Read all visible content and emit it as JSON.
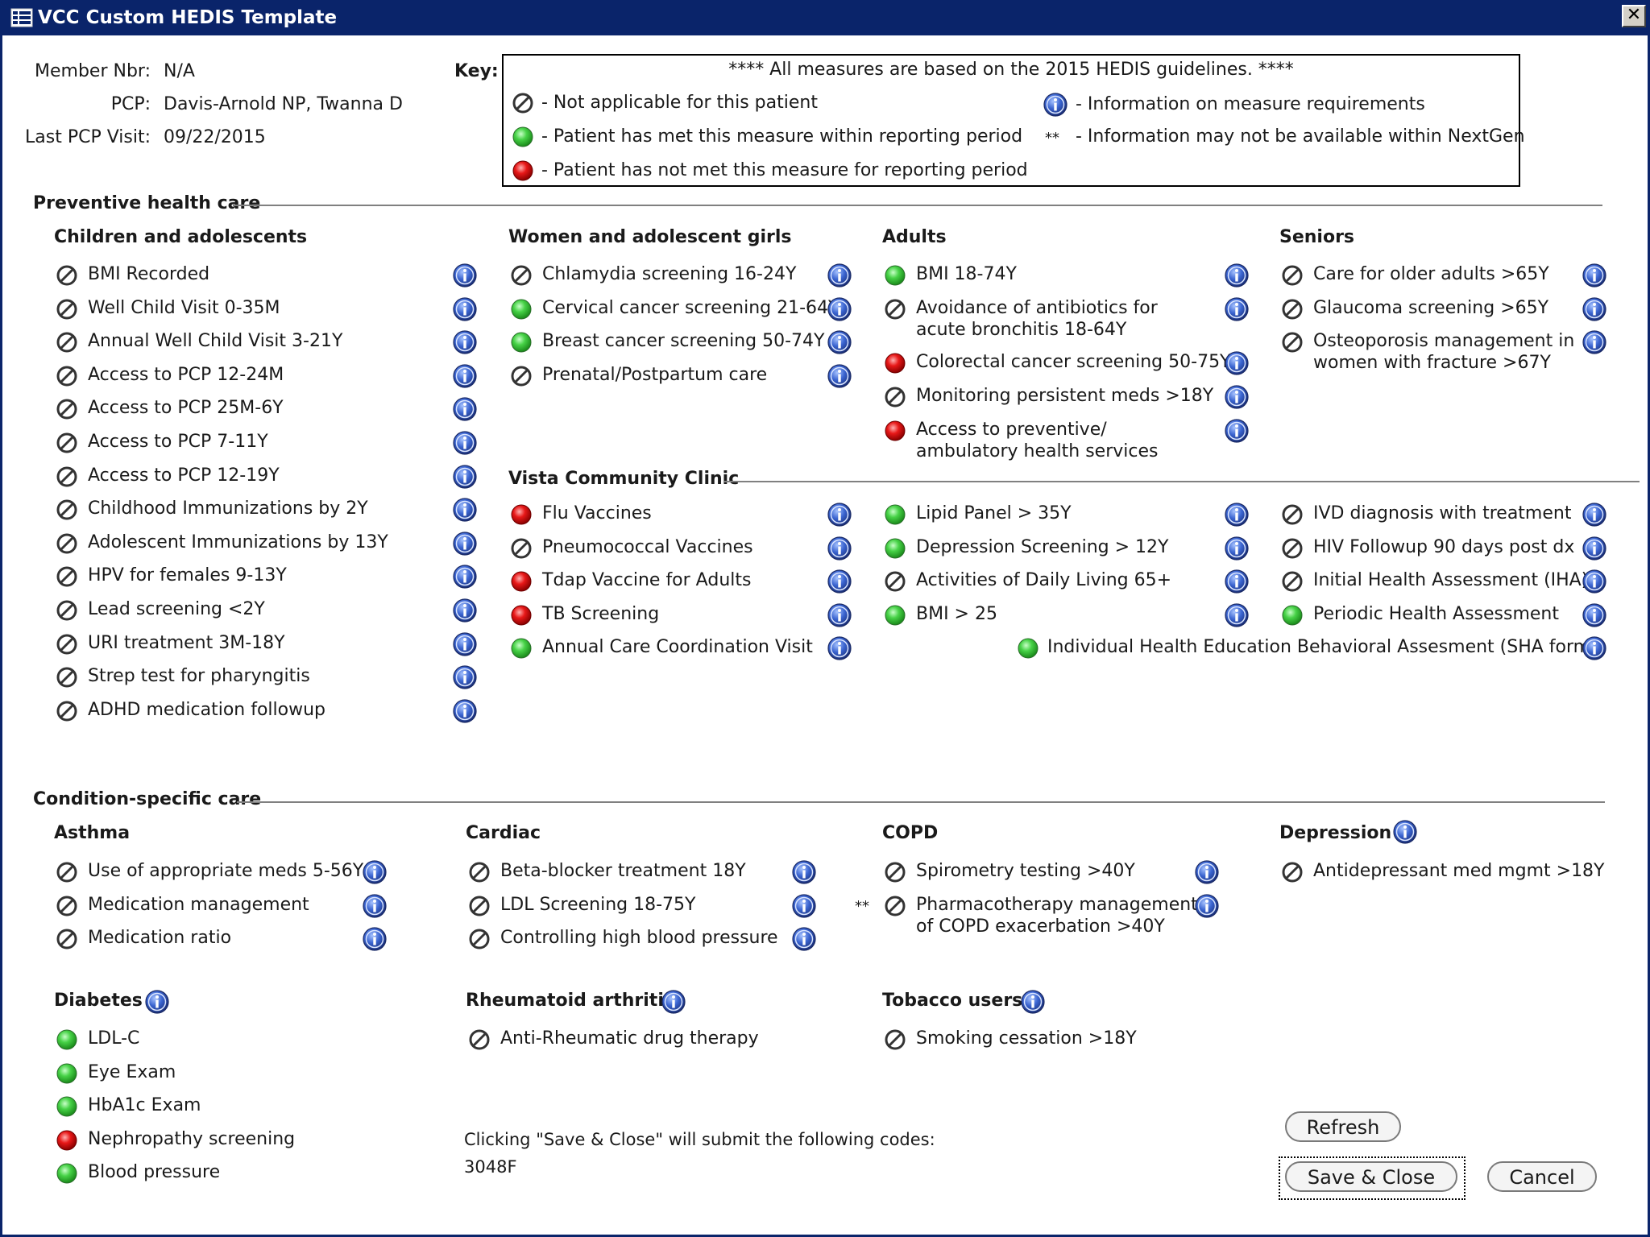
{
  "window": {
    "title": "VCC Custom HEDIS Template",
    "close_label": "✕"
  },
  "member": {
    "member_nbr_label": "Member Nbr:",
    "member_nbr": "N/A",
    "pcp_label": "PCP:",
    "pcp": "Davis-Arnold NP, Twanna D",
    "last_visit_label": "Last PCP Visit:",
    "last_visit": "09/22/2015"
  },
  "key": {
    "label": "Key:",
    "header": "**** All measures are based on the 2015 HEDIS guidelines. ****",
    "na": "- Not applicable for this patient",
    "met": "- Patient has met this measure within reporting period",
    "notmet": "- Patient has not met this measure for reporting period",
    "info": "- Information on measure requirements",
    "star_glyph": "**",
    "star": "- Information may not be available within NextGen"
  },
  "sections": {
    "preventive": "Preventive health care",
    "vcc": "Vista Community Clinic",
    "condition": "Condition-specific care"
  },
  "groups": {
    "children": "Children and adolescents",
    "women": "Women and adolescent girls",
    "adults": "Adults",
    "seniors": "Seniors",
    "asthma": "Asthma",
    "cardiac": "Cardiac",
    "copd": "COPD",
    "depression": "Depression",
    "diabetes": "Diabetes",
    "ra": "Rheumatoid arthritis",
    "tobacco": "Tobacco users"
  },
  "measures": {
    "children": [
      {
        "label": "BMI Recorded",
        "status": "na"
      },
      {
        "label": "Well Child Visit 0-35M",
        "status": "na"
      },
      {
        "label": "Annual Well Child Visit 3-21Y",
        "status": "na"
      },
      {
        "label": "Access to PCP 12-24M",
        "status": "na"
      },
      {
        "label": "Access to PCP 25M-6Y",
        "status": "na"
      },
      {
        "label": "Access to PCP 7-11Y",
        "status": "na"
      },
      {
        "label": "Access to PCP 12-19Y",
        "status": "na"
      },
      {
        "label": "Childhood Immunizations by 2Y",
        "status": "na"
      },
      {
        "label": "Adolescent Immunizations by 13Y",
        "status": "na"
      },
      {
        "label": "HPV for females 9-13Y",
        "status": "na"
      },
      {
        "label": "Lead screening <2Y",
        "status": "na"
      },
      {
        "label": "URI treatment 3M-18Y",
        "status": "na"
      },
      {
        "label": "Strep test for pharyngitis",
        "status": "na"
      },
      {
        "label": "ADHD medication followup",
        "status": "na"
      }
    ],
    "women": [
      {
        "label": "Chlamydia screening 16-24Y",
        "status": "na"
      },
      {
        "label": "Cervical cancer screening 21-64Y",
        "status": "met"
      },
      {
        "label": "Breast cancer screening 50-74Y",
        "status": "met"
      },
      {
        "label": "Prenatal/Postpartum care",
        "status": "na"
      }
    ],
    "adults": [
      {
        "label": "BMI 18-74Y",
        "status": "met"
      },
      {
        "label": "Avoidance of antibiotics for",
        "label2": "acute bronchitis 18-64Y",
        "status": "na"
      },
      {
        "label": "Colorectal cancer screening 50-75Y",
        "status": "notmet"
      },
      {
        "label": "Monitoring persistent meds >18Y",
        "status": "na"
      },
      {
        "label": "Access to preventive/",
        "label2": "ambulatory health services",
        "status": "notmet"
      }
    ],
    "seniors": [
      {
        "label": "Care for older adults >65Y",
        "status": "na"
      },
      {
        "label": "Glaucoma screening >65Y",
        "status": "na"
      },
      {
        "label": "Osteoporosis management in",
        "label2": "women with fracture >67Y",
        "status": "na"
      }
    ],
    "vcc_col1": [
      {
        "label": "Flu Vaccines",
        "status": "notmet"
      },
      {
        "label": "Pneumococcal Vaccines",
        "status": "na"
      },
      {
        "label": "Tdap Vaccine for Adults",
        "status": "notmet"
      },
      {
        "label": "TB Screening",
        "status": "notmet"
      },
      {
        "label": "Annual Care Coordination Visit",
        "status": "met"
      }
    ],
    "vcc_col2": [
      {
        "label": "Lipid Panel > 35Y",
        "status": "met"
      },
      {
        "label": "Depression Screening > 12Y",
        "status": "met"
      },
      {
        "label": "Activities of Daily Living 65+",
        "status": "na"
      },
      {
        "label": "BMI > 25",
        "status": "met"
      }
    ],
    "vcc_col3": [
      {
        "label": "IVD diagnosis with treatment",
        "status": "na"
      },
      {
        "label": "HIV Followup 90 days post dx",
        "status": "na"
      },
      {
        "label": "Initial Health Assessment (IHA)",
        "status": "na"
      },
      {
        "label": "Periodic Health Assessment",
        "status": "met"
      }
    ],
    "vcc_wide": {
      "label": "Individual Health Education Behavioral Assesment (SHA form)",
      "status": "met"
    },
    "asthma": [
      {
        "label": "Use of appropriate meds 5-56Y",
        "status": "na"
      },
      {
        "label": "Medication management",
        "status": "na"
      },
      {
        "label": "Medication ratio",
        "status": "na"
      }
    ],
    "cardiac": [
      {
        "label": "Beta-blocker treatment 18Y",
        "status": "na"
      },
      {
        "label": "LDL Screening 18-75Y",
        "status": "na"
      },
      {
        "label": "Controlling high blood pressure",
        "status": "na"
      }
    ],
    "copd": [
      {
        "label": "Spirometry testing >40Y",
        "status": "na"
      },
      {
        "label": "Pharmacotherapy management",
        "label2": "of COPD exacerbation >40Y",
        "status": "na",
        "star": "**"
      }
    ],
    "depression": [
      {
        "label": "Antidepressant med mgmt >18Y",
        "status": "na"
      }
    ],
    "diabetes": [
      {
        "label": "LDL-C",
        "status": "met"
      },
      {
        "label": "Eye Exam",
        "status": "met"
      },
      {
        "label": "HbA1c Exam",
        "status": "met"
      },
      {
        "label": "Nephropathy screening",
        "status": "notmet"
      },
      {
        "label": "Blood pressure",
        "status": "met"
      }
    ],
    "ra": [
      {
        "label": "Anti-Rheumatic drug therapy",
        "status": "na"
      }
    ],
    "tobacco": [
      {
        "label": "Smoking cessation >18Y",
        "status": "na"
      }
    ]
  },
  "codes": {
    "note": "Clicking \"Save & Close\" will submit the following codes:",
    "values": "3048F"
  },
  "buttons": {
    "refresh": "Refresh",
    "save_close": "Save & Close",
    "cancel": "Cancel"
  },
  "colors": {
    "met": "#3cc43c",
    "notmet": "#e01010",
    "info": "#2a52be",
    "title_bar": "#0a246a"
  }
}
